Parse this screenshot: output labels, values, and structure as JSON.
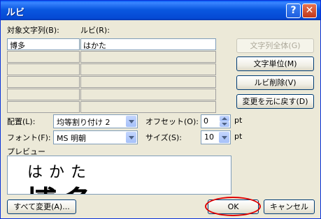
{
  "window": {
    "title": "ルビ",
    "help_glyph": "?",
    "close_glyph": "✕"
  },
  "grid": {
    "col1_header": "対象文字列(B):",
    "col2_header": "ルビ(R):",
    "rows": [
      {
        "base": "博多",
        "ruby": "はかた"
      },
      {
        "base": "",
        "ruby": ""
      },
      {
        "base": "",
        "ruby": ""
      },
      {
        "base": "",
        "ruby": ""
      },
      {
        "base": "",
        "ruby": ""
      },
      {
        "base": "",
        "ruby": ""
      }
    ]
  },
  "side_buttons": {
    "whole_string": "文字列全体(G)",
    "per_char": "文字単位(M)",
    "delete_ruby": "ルビ削除(V)",
    "restore": "変更を元に戻す(D)"
  },
  "options": {
    "alignment_label": "配置(L):",
    "alignment_value": "均等割り付け 2",
    "offset_label": "オフセット(O):",
    "offset_value": "0",
    "offset_unit": "pt",
    "font_label": "フォント(F):",
    "font_value": "MS 明朝",
    "size_label": "サイズ(S):",
    "size_value": "10",
    "size_unit": "pt"
  },
  "preview": {
    "label": "プレビュー",
    "ruby_text": "はかた",
    "base_text": "博多"
  },
  "footer": {
    "change_all": "すべて変更(A)...",
    "ok": "OK",
    "cancel": "キャンセル"
  },
  "colors": {
    "title_bar": "#0a58e0",
    "dialog_bg": "#ece9d8",
    "highlight_ellipse": "#e00000"
  }
}
